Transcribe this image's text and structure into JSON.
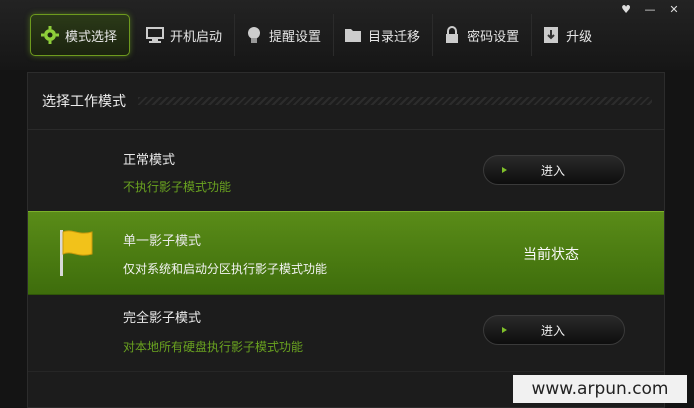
{
  "tabs": [
    {
      "label": "模式选择",
      "icon": "gear-icon",
      "active": true
    },
    {
      "label": "开机启动",
      "icon": "monitor-icon"
    },
    {
      "label": "提醒设置",
      "icon": "bulb-icon"
    },
    {
      "label": "目录迁移",
      "icon": "folder-icon"
    },
    {
      "label": "密码设置",
      "icon": "lock-icon"
    },
    {
      "label": "升级",
      "icon": "download-icon"
    }
  ],
  "panel": {
    "title": "选择工作模式"
  },
  "modes": [
    {
      "name": "正常模式",
      "desc": "不执行影子模式功能",
      "button": "进入"
    },
    {
      "name": "单一影子模式",
      "desc": "仅对系统和启动分区执行影子模式功能",
      "status": "当前状态",
      "icon": "flag-icon"
    },
    {
      "name": "完全影子模式",
      "desc": "对本地所有硬盘执行影子模式功能",
      "button": "进入"
    }
  ],
  "watermark": "www.arpun.com",
  "colors": {
    "accent": "#6aa320",
    "selected_row": "#4d7e12"
  }
}
